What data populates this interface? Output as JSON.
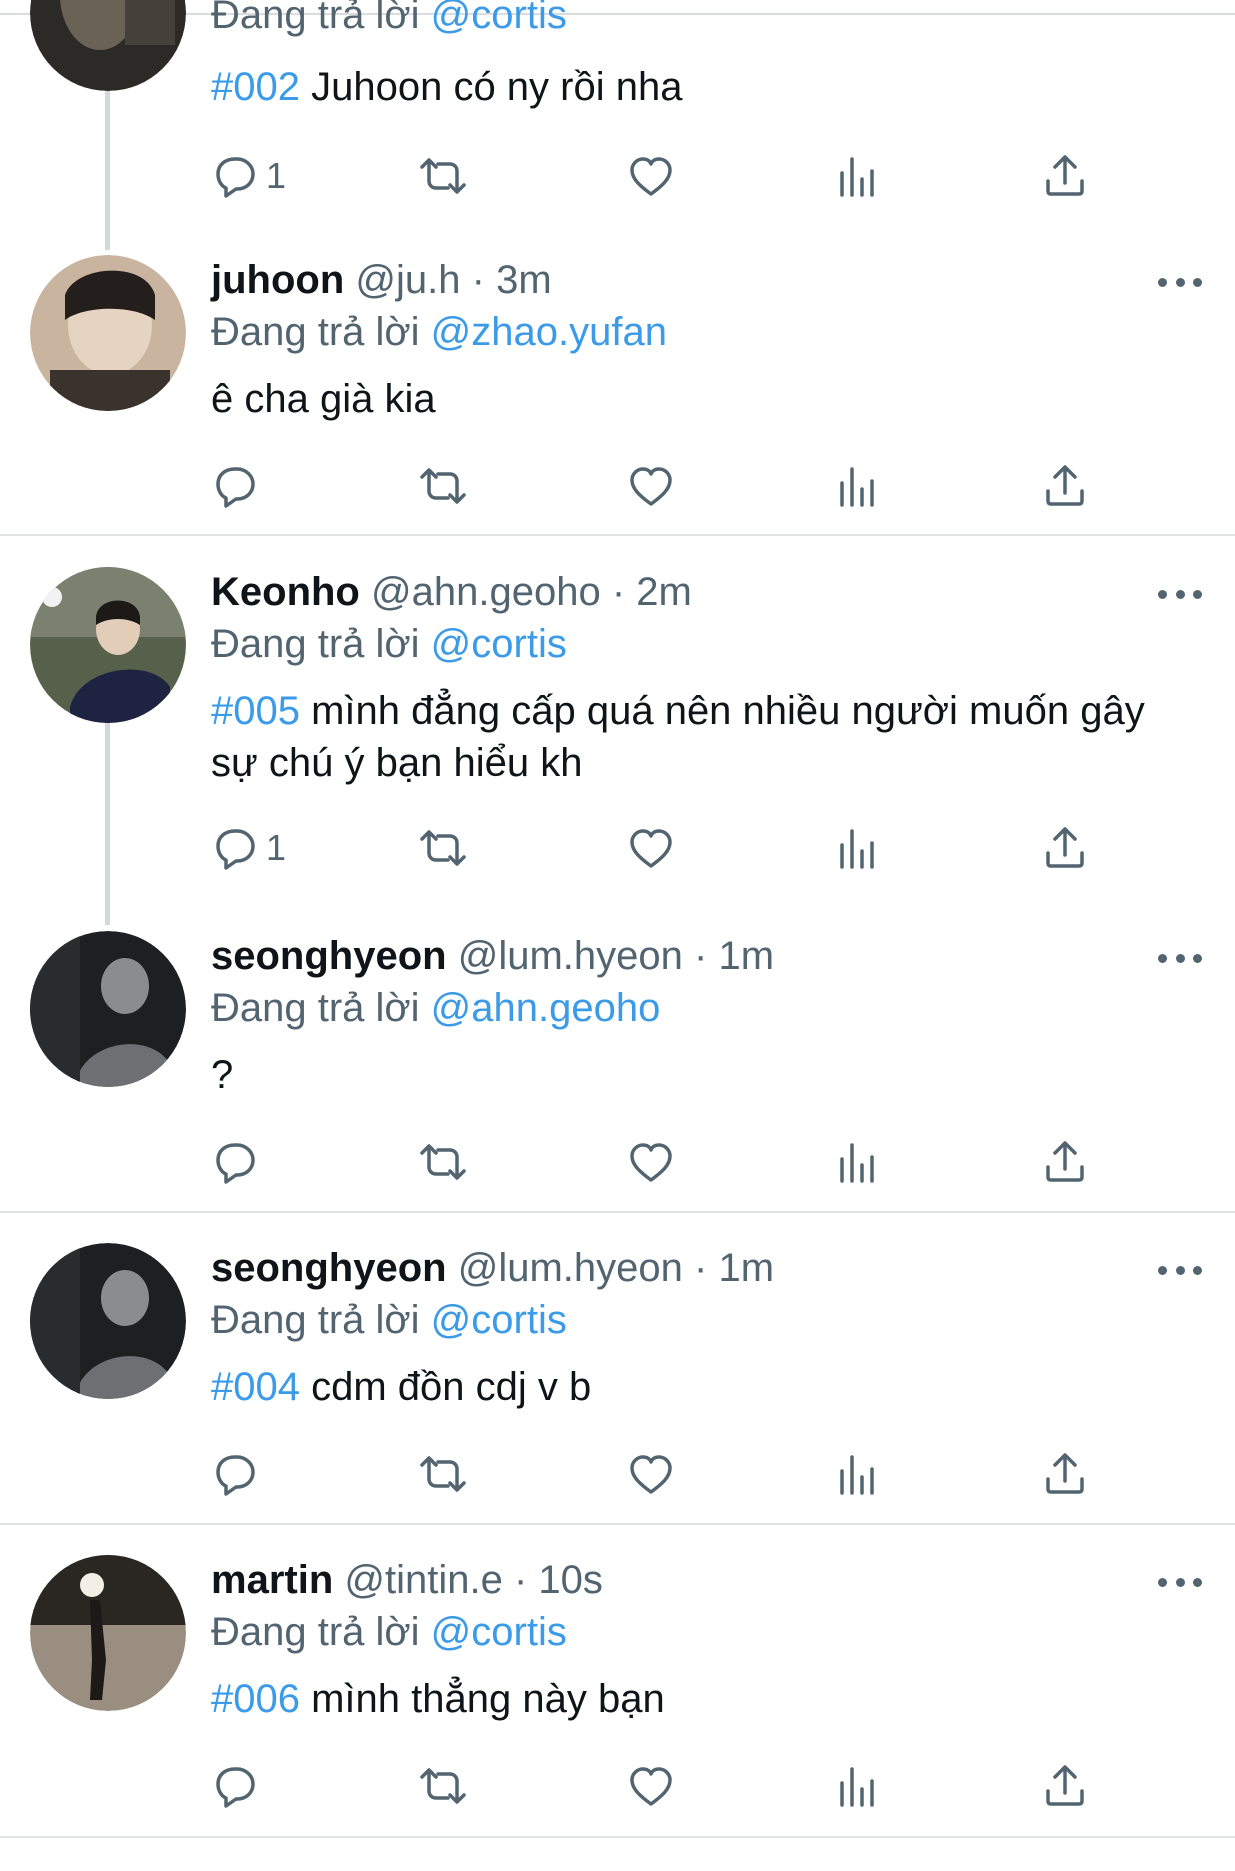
{
  "tweets": [
    {
      "name": "",
      "handle": "",
      "time": "",
      "reply_prefix": "Đang trả lời",
      "reply_to": "@cortis",
      "hashtag": "#002",
      "text": " Juhoon có ny rồi nha",
      "reply_count": "1",
      "avatar_colors": [
        "#2c2a27",
        "#6b6256"
      ]
    },
    {
      "name": "juhoon",
      "handle": "@ju.h",
      "time": "3m",
      "reply_prefix": "Đang trả lời",
      "reply_to": "@zhao.yufan",
      "hashtag": "",
      "text": "ê cha già kia",
      "reply_count": "",
      "avatar_colors": [
        "#3a332d",
        "#c9b4a0"
      ]
    },
    {
      "name": "Keonho",
      "handle": "@ahn.geoho",
      "time": "2m",
      "reply_prefix": "Đang trả lời",
      "reply_to": "@cortis",
      "hashtag": "#005",
      "text": " mình đẳng cấp quá nên nhiều người muốn gây sự chú ý bạn hiểu kh",
      "reply_count": "1",
      "avatar_colors": [
        "#56604a",
        "#1d2340"
      ]
    },
    {
      "name": "seonghyeon",
      "handle": "@lum.hyeon",
      "time": "1m",
      "reply_prefix": "Đang trả lời",
      "reply_to": "@ahn.geoho",
      "hashtag": "",
      "text": "?",
      "reply_count": "",
      "avatar_colors": [
        "#1e1f21",
        "#8a8c8e"
      ]
    },
    {
      "name": "seonghyeon",
      "handle": "@lum.hyeon",
      "time": "1m",
      "reply_prefix": "Đang trả lời",
      "reply_to": "@cortis",
      "hashtag": "#004",
      "text": " cdm đồn cdj v b",
      "reply_count": "",
      "avatar_colors": [
        "#1e1f21",
        "#8a8c8e"
      ]
    },
    {
      "name": "martin",
      "handle": "@tintin.e",
      "time": "10s",
      "reply_prefix": "Đang trả lời",
      "reply_to": "@cortis",
      "hashtag": "#006",
      "text": " mình thẳng này bạn",
      "reply_count": "",
      "avatar_colors": [
        "#2a2622",
        "#9a8e80"
      ]
    }
  ],
  "separator": "·",
  "icons": {
    "reply": "reply-icon",
    "retweet": "retweet-icon",
    "like": "heart-icon",
    "views": "views-icon",
    "share": "share-icon",
    "more": "more-icon"
  },
  "colors": {
    "link": "#3b9be8",
    "secondary": "#536471",
    "primary": "#0f1419",
    "divider": "#dfe3e6"
  }
}
